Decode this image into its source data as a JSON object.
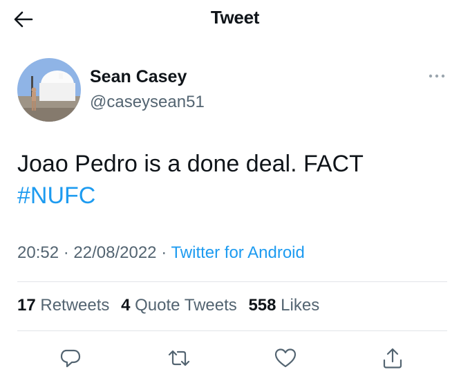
{
  "header": {
    "title": "Tweet",
    "back_icon": "arrow-left-icon"
  },
  "author": {
    "name": "Sean Casey",
    "handle": "@caseysean51"
  },
  "tweet": {
    "text": "Joao Pedro is a done deal. FACT",
    "hashtag": "#NUFC"
  },
  "meta": {
    "time": "20:52",
    "date": "22/08/2022",
    "separator": "·",
    "source": "Twitter for Android"
  },
  "stats": {
    "retweets_count": "17",
    "retweets_label": "Retweets",
    "quotes_count": "4",
    "quotes_label": "Quote Tweets",
    "likes_count": "558",
    "likes_label": "Likes"
  },
  "colors": {
    "accent": "#1d9bf0",
    "secondary_text": "#536471",
    "primary_text": "#0f1419",
    "divider": "#e1e4e8"
  },
  "icons": [
    "arrow-left-icon",
    "more-icon",
    "reply-icon",
    "retweet-icon",
    "like-icon",
    "share-icon"
  ]
}
